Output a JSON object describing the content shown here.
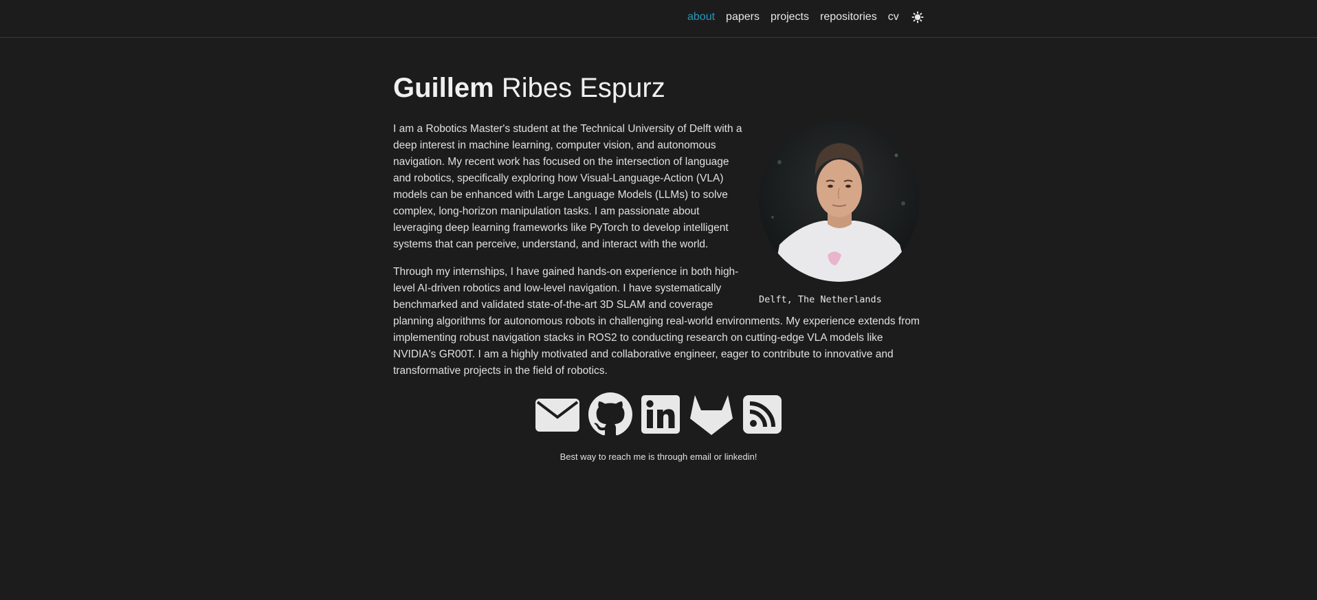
{
  "nav": {
    "items": [
      {
        "label": "about",
        "active": true
      },
      {
        "label": "papers",
        "active": false
      },
      {
        "label": "projects",
        "active": false
      },
      {
        "label": "repositories",
        "active": false
      },
      {
        "label": "cv",
        "active": false
      }
    ],
    "theme_icon": "sun-icon"
  },
  "header": {
    "first_name": "Guillem",
    "last_name": "Ribes Espurz"
  },
  "profile": {
    "location": "Delft, The Netherlands"
  },
  "bio": {
    "paragraph_1": "I am a Robotics Master's student at the Technical University of Delft with a deep interest in machine learning, computer vision, and autonomous navigation. My recent work has focused on the intersection of language and robotics, specifically exploring how Visual-Language-Action (VLA) models can be enhanced with Large Language Models (LLMs) to solve complex, long-horizon manipulation tasks. I am passionate about leveraging deep learning frameworks like PyTorch to develop intelligent systems that can perceive, understand, and interact with the world.",
    "paragraph_2": "Through my internships, I have gained hands-on experience in both high-level AI-driven robotics and low-level navigation. I have systematically benchmarked and validated state-of-the-art 3D SLAM and coverage planning algorithms for autonomous robots in challenging real-world environments. My experience extends from implementing robust navigation stacks in ROS2 to conducting research on cutting-edge VLA models like NVIDIA's GR00T. I am a highly motivated and collaborative engineer, eager to contribute to innovative and transformative projects in the field of robotics."
  },
  "social": {
    "icons": [
      "email-icon",
      "github-icon",
      "linkedin-icon",
      "gitlab-icon",
      "rss-icon"
    ],
    "note": "Best way to reach me is through email or linkedin!"
  },
  "colors": {
    "background": "#1c1c1d",
    "accent": "#2698ba",
    "text": "#e8e8e8"
  }
}
